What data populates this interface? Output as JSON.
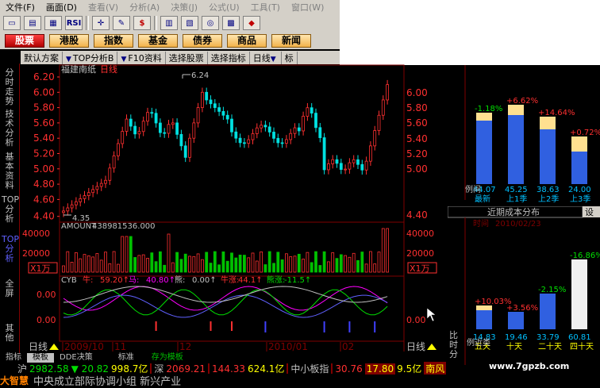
{
  "menu": [
    "文件(F)",
    "画面(D)",
    "查看(V)",
    "分析(A)",
    "决策(J)",
    "公式(U)",
    "工具(T)",
    "窗口(W)"
  ],
  "toolbar_icons": [
    "open-icon",
    "screen-icon",
    "data-icon",
    "rsi-icon",
    "crosshair-icon",
    "drawing-icon",
    "money-icon",
    "indicator-icon",
    "split-icon",
    "binoculars-icon",
    "calendar-icon",
    "reconnect-icon"
  ],
  "toolbar_labels": {
    "rsi": "RSI",
    "money": "$"
  },
  "market_tabs": [
    "股票",
    "港股",
    "指数",
    "基金",
    "债券",
    "商品",
    "新闻"
  ],
  "analysis_bar": {
    "scheme": "默认方案",
    "top": "TOP分析B",
    "f10": "F10资料",
    "select_stock": "选择股票",
    "select_indicator": "选择指标",
    "period": "日线",
    "tail": "标"
  },
  "left_nav": [
    "分时走势",
    "技术分析",
    "基本资料",
    "TOP分析",
    "TOP分析",
    "全屏",
    "其他"
  ],
  "main_chart": {
    "stock_name": "福建南纸",
    "period": "日线",
    "high_marker": "6.24",
    "low_marker": "4.35",
    "price_ticks": [
      "6.20",
      "6.00",
      "5.80",
      "5.60",
      "5.40",
      "5.20",
      "5.00",
      "4.80",
      "4.60",
      "4.40"
    ],
    "right_price_ticks": [
      "6.00",
      "5.80",
      "5.60",
      "5.40",
      "5.20",
      "5.00",
      "4.40"
    ],
    "volume_label": "AMOUNT",
    "volume_value": "438981536.000",
    "volume_ticks": [
      "40000",
      "20000"
    ],
    "volume_unit": "X1万",
    "cyb_label": "CYB",
    "cyb_items": [
      {
        "name": "牛",
        "value": "59.20"
      },
      {
        "name": "马",
        "value": "40.80"
      },
      {
        "name": "熊",
        "value": "0.00"
      },
      {
        "name": "牛涨",
        "value": "44.1"
      },
      {
        "name": "熊涨",
        "value": "-11.5"
      }
    ],
    "cyb_ticks": [
      "0.00",
      "0.00"
    ],
    "date_labels": [
      "2009/10",
      "11",
      "12",
      "2010/01",
      "02"
    ],
    "period_footer": "日线",
    "period_footer_right": "日线"
  },
  "indicator_tabs": [
    "指标",
    "模板",
    "DDE决策",
    "标准",
    "存为模板"
  ],
  "right_top": {
    "bars": [
      {
        "pct": "-1.18%",
        "price": "44.07",
        "label": "最新"
      },
      {
        "pct": "+6.62%",
        "price": "45.25",
        "label": "上1季"
      },
      {
        "pct": "+14.64%",
        "price": "38.63",
        "label": "上2季"
      },
      {
        "pct": "+0.72%",
        "price": "24.00",
        "label": "上3季"
      }
    ],
    "axis_label": "例间"
  },
  "right_bottom": {
    "title": "近期成本分布",
    "tab": "设",
    "time_label": "时间",
    "time_value": "2010/02/23",
    "bars": [
      {
        "pct": "+10.03%",
        "price": "14.83",
        "label": "五天"
      },
      {
        "pct": "+3.56%",
        "price": "19.46",
        "label": "十天"
      },
      {
        "pct": "-2.15%",
        "price": "33.79",
        "label": "二十天"
      },
      {
        "pct": "-16.86%",
        "price": "60.81",
        "label": "四十天"
      }
    ],
    "side_labels": [
      "比",
      "时",
      "分"
    ],
    "axis_label": "例近类"
  },
  "index_bar": {
    "sh_label": "沪",
    "sh_value": "2982.58",
    "sh_change": "▼ 20.82",
    "sh_amount": "998.7亿",
    "sz_label": "深",
    "sz_value": "2069.21",
    "sz_change": "144.33",
    "sz_amount": "624.1亿",
    "sme_label": "中小板指",
    "sme_value": "30.76",
    "sme_change": "17.80",
    "sme_amount": "9.5亿",
    "tail": "南风"
  },
  "news_bar": {
    "brand": "大智慧",
    "headline": "中央成立部际协调小组 新兴产业"
  },
  "watermark": "www.7gpzb.com",
  "colors": {
    "up": "#ff3030",
    "down": "#00e000",
    "axis": "#800000",
    "accent": "#ffff00"
  }
}
